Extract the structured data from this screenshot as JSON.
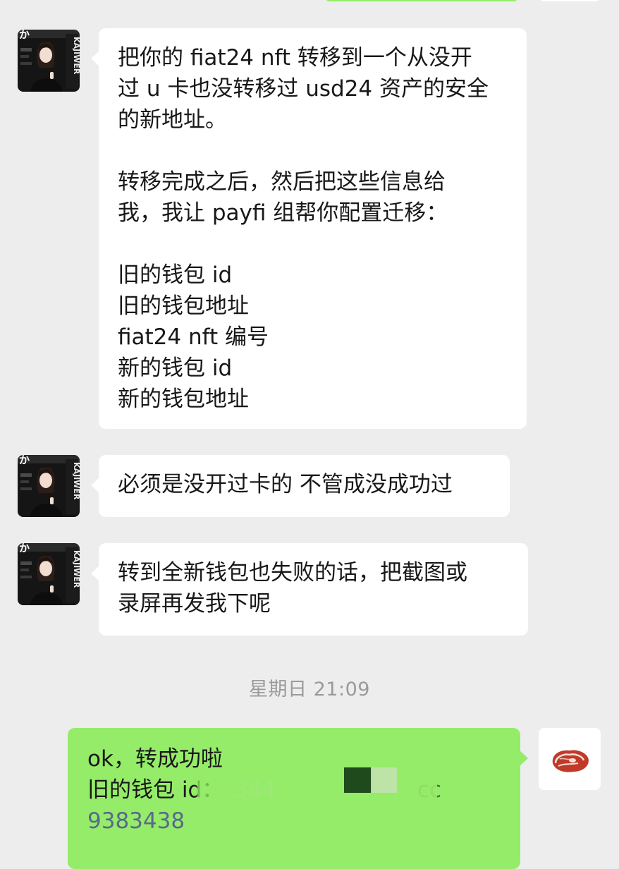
{
  "friend_avatar_name": "KAJIWER",
  "messages_in": [
    {
      "lines": [
        "把你的 fiat24 nft 转移到一个从没开",
        "过 u 卡也没转移过 usd24 资产的安全",
        "的新地址。",
        "",
        "转移完成之后，然后把这些信息给",
        "我，我让 payfi 组帮你配置迁移：",
        "",
        "旧的钱包 id",
        "旧的钱包地址",
        "fiat24 nft 编号",
        "新的钱包 id",
        "新的钱包地址"
      ]
    },
    {
      "lines": [
        "必须是没开过卡的 不管成没成功过"
      ]
    },
    {
      "lines": [
        "转到全新钱包也失败的话，把截图或",
        "录屏再发我下呢"
      ]
    }
  ],
  "timestamp": "星期日 21:09",
  "message_out": {
    "line1": "ok，转成功啦",
    "line2_label": "旧的钱包 id：",
    "line2_fragment_a": "344",
    "line2_fragment_b": "cc",
    "line3_fragment": "9383438"
  },
  "colors": {
    "background": "#ededed",
    "incoming_bubble": "#ffffff",
    "outgoing_bubble": "#95ec69",
    "timestamp": "#9a9a9a"
  }
}
